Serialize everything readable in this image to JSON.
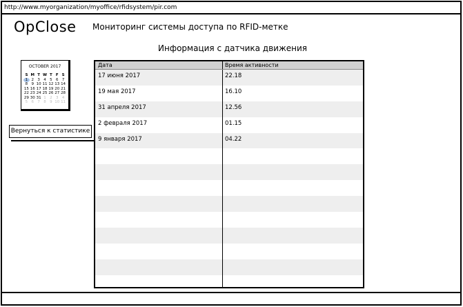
{
  "browser": {
    "url": "http://www.myorganization/myoffice/rfidsystem/pir.com"
  },
  "header": {
    "logo": "OpClose",
    "subtitle": "Мониторинг системы доступа по RFID-метке"
  },
  "section": {
    "title": "Информация с датчика движения"
  },
  "calendar": {
    "month_label": "OCTOBER 2017",
    "weekdays": [
      "S",
      "M",
      "T",
      "W",
      "T",
      "F",
      "S"
    ],
    "weeks": [
      [
        "1",
        "2",
        "3",
        "4",
        "5",
        "6",
        "7"
      ],
      [
        "8",
        "9",
        "10",
        "11",
        "12",
        "13",
        "14"
      ],
      [
        "15",
        "16",
        "17",
        "18",
        "19",
        "20",
        "21"
      ],
      [
        "22",
        "23",
        "24",
        "25",
        "26",
        "27",
        "28"
      ],
      [
        "29",
        "30",
        "31",
        "1",
        "2",
        "3",
        "4"
      ],
      [
        "5",
        "6",
        "7",
        "8",
        "9",
        "10",
        "11"
      ]
    ],
    "selected_day": "1",
    "accent": "#a8c4e8"
  },
  "actions": {
    "back_label": "Вернуться к статистике"
  },
  "table": {
    "columns": [
      "Дата",
      "Время активности"
    ],
    "rows": [
      [
        "17 июня 2017",
        "22.18"
      ],
      [
        "19 мая 2017",
        "16.10"
      ],
      [
        "31 апреля 2017",
        "12.56"
      ],
      [
        "2 февраля 2017",
        "01.15"
      ],
      [
        "9 января 2017",
        "04.22"
      ],
      [
        "",
        ""
      ],
      [
        "",
        ""
      ],
      [
        "",
        ""
      ],
      [
        "",
        ""
      ],
      [
        "",
        ""
      ],
      [
        "",
        ""
      ],
      [
        "",
        ""
      ],
      [
        "",
        ""
      ],
      [
        "",
        ""
      ]
    ],
    "stripe_color": "#eeeeee",
    "header_color": "#d0d0d0"
  }
}
